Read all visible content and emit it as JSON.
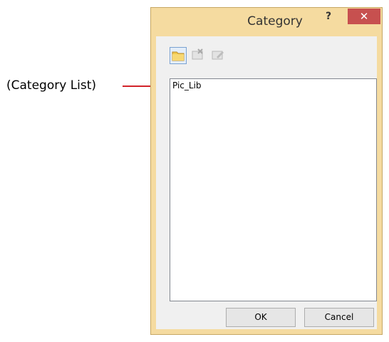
{
  "annotation": {
    "label": "(Category List)"
  },
  "dialog": {
    "title": "Category",
    "help_label": "?",
    "close_label": "✕",
    "toolbar": [
      {
        "name": "new-category",
        "icon": "folder-icon",
        "enabled": true
      },
      {
        "name": "delete-category",
        "icon": "delete-icon",
        "enabled": false
      },
      {
        "name": "rename-category",
        "icon": "edit-icon",
        "enabled": false
      }
    ],
    "list": {
      "items": [
        "Pic_Lib"
      ]
    },
    "ok_label": "OK",
    "cancel_label": "Cancel"
  },
  "colors": {
    "frame": "#f5dba0",
    "close": "#c7504f",
    "leader": "#d2232a"
  }
}
